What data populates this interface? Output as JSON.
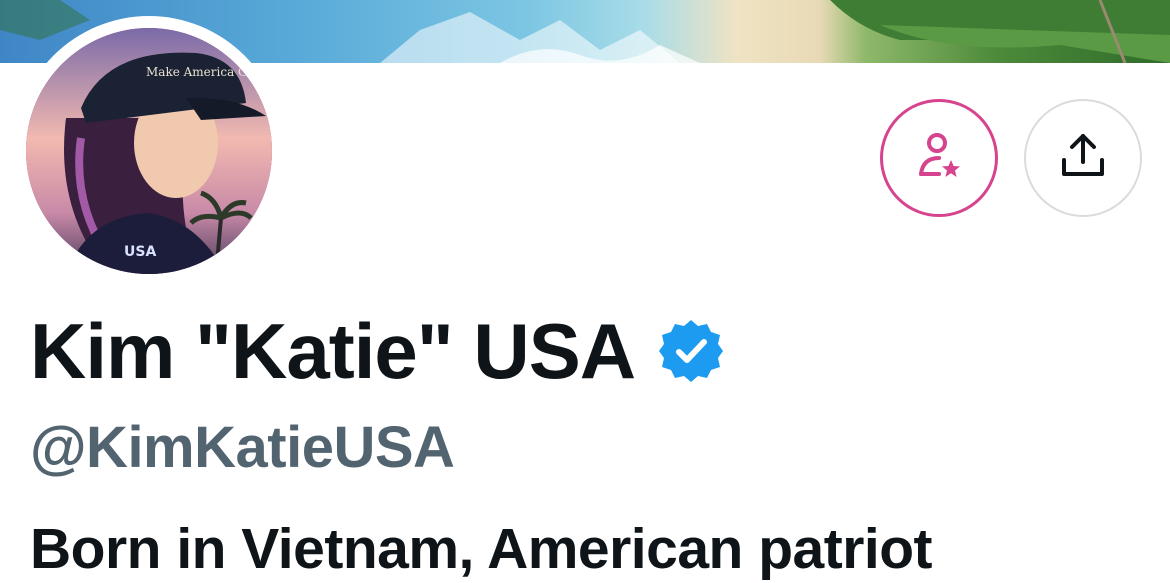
{
  "profile": {
    "display_name": "Kim \"Katie\" USA",
    "handle": "@KimKatieUSA",
    "bio": "Born in Vietnam, American patriot",
    "verified": true
  },
  "avatar": {
    "hat_text": "Make America Great Again",
    "badge_text": "USA"
  },
  "buttons": {
    "subscribe_icon": "person-star-icon",
    "share_icon": "share-upload-icon"
  },
  "colors": {
    "accent_pink": "#d6438e",
    "verified_blue": "#1d9bf0",
    "text_primary": "#0f1419",
    "text_secondary": "#536471"
  }
}
